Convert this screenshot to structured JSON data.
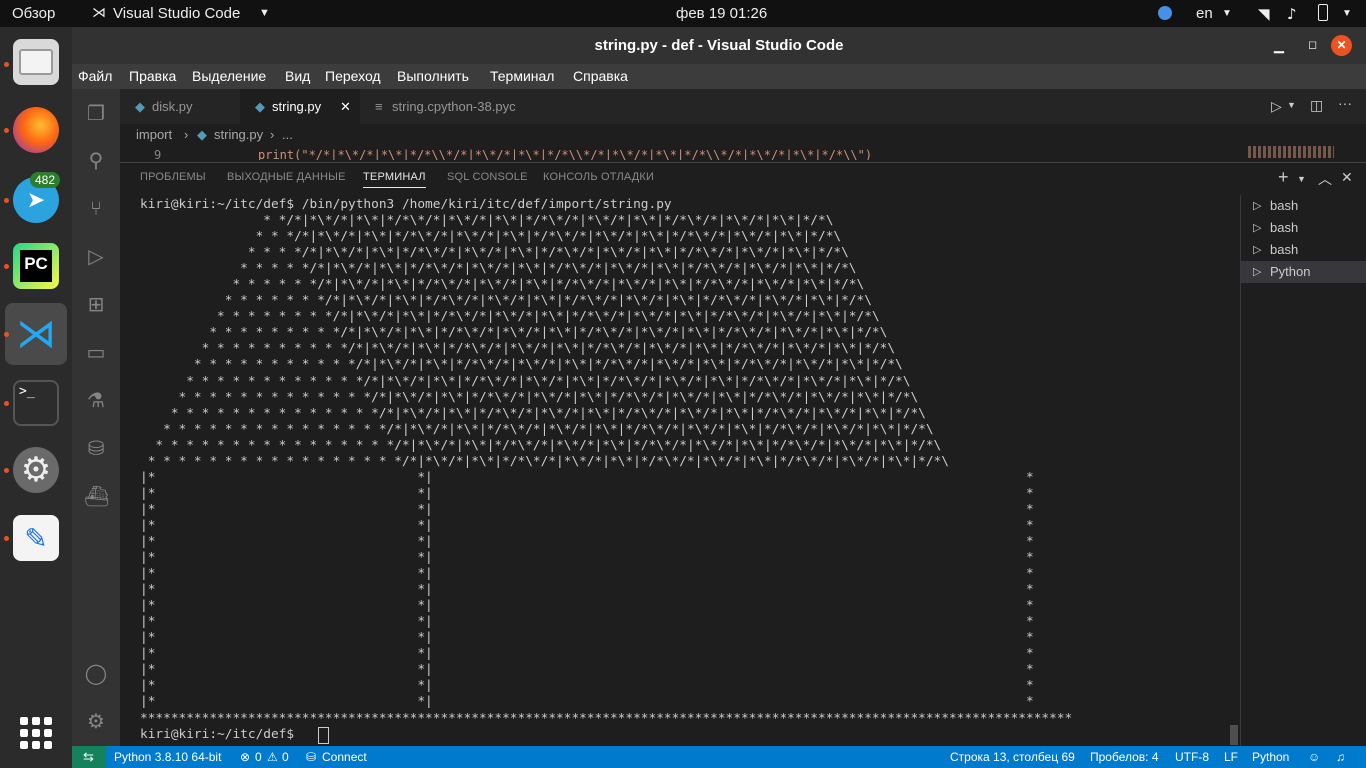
{
  "topbar": {
    "overview": "Обзор",
    "app_name": "Visual Studio Code",
    "datetime": "фев 19  01:26",
    "lang": "en"
  },
  "dock": {
    "telegram_badge": "482"
  },
  "window": {
    "title": "string.py - def - Visual Studio Code"
  },
  "menu": [
    "Файл",
    "Правка",
    "Выделение",
    "Вид",
    "Переход",
    "Выполнить",
    "Терминал",
    "Справка"
  ],
  "tabs": [
    {
      "label": "disk.py"
    },
    {
      "label": "string.py"
    },
    {
      "label": "string.cpython-38.pyc"
    }
  ],
  "breadcrumb": {
    "folder": "import",
    "file": "string.py",
    "more": "..."
  },
  "editor": {
    "line_number": "9",
    "code": "print(\"*/*|*\\*/*|*\\*|*/*\\\\*/*|*\\*/*|*\\*|*/*\\\\*/*|*\\*/*|*\\*|*/*\\\\*/*|*\\*/*|*\\*|*/*\\\\\")"
  },
  "panel": {
    "tabs": [
      "ПРОБЛЕМЫ",
      "ВЫХОДНЫЕ ДАННЫЕ",
      "ТЕРМИНАЛ",
      "SQL CONSOLE",
      "КОНСОЛЬ ОТЛАДКИ"
    ],
    "active_tab": "ТЕРМИНАЛ"
  },
  "terminal": {
    "output": "kiri@kiri:~/itc/def$ /bin/python3 /home/kiri/itc/def/import/string.py\n                * */*|*\\*/*|*\\*|*/*\\*/*|*\\*/*|*\\*|*/*\\*/*|*\\*/*|*\\*|*/*\\*/*|*\\*/*|*\\*|*/*\\\n               * * */*|*\\*/*|*\\*|*/*\\*/*|*\\*/*|*\\*|*/*\\*/*|*\\*/*|*\\*|*/*\\*/*|*\\*/*|*\\*|*/*\\\n              * * * */*|*\\*/*|*\\*|*/*\\*/*|*\\*/*|*\\*|*/*\\*/*|*\\*/*|*\\*|*/*\\*/*|*\\*/*|*\\*|*/*\\\n             * * * * */*|*\\*/*|*\\*|*/*\\*/*|*\\*/*|*\\*|*/*\\*/*|*\\*/*|*\\*|*/*\\*/*|*\\*/*|*\\*|*/*\\\n            * * * * * */*|*\\*/*|*\\*|*/*\\*/*|*\\*/*|*\\*|*/*\\*/*|*\\*/*|*\\*|*/*\\*/*|*\\*/*|*\\*|*/*\\\n           * * * * * * */*|*\\*/*|*\\*|*/*\\*/*|*\\*/*|*\\*|*/*\\*/*|*\\*/*|*\\*|*/*\\*/*|*\\*/*|*\\*|*/*\\\n          * * * * * * * */*|*\\*/*|*\\*|*/*\\*/*|*\\*/*|*\\*|*/*\\*/*|*\\*/*|*\\*|*/*\\*/*|*\\*/*|*\\*|*/*\\\n         * * * * * * * * */*|*\\*/*|*\\*|*/*\\*/*|*\\*/*|*\\*|*/*\\*/*|*\\*/*|*\\*|*/*\\*/*|*\\*/*|*\\*|*/*\\\n        * * * * * * * * * */*|*\\*/*|*\\*|*/*\\*/*|*\\*/*|*\\*|*/*\\*/*|*\\*/*|*\\*|*/*\\*/*|*\\*/*|*\\*|*/*\\\n       * * * * * * * * * * */*|*\\*/*|*\\*|*/*\\*/*|*\\*/*|*\\*|*/*\\*/*|*\\*/*|*\\*|*/*\\*/*|*\\*/*|*\\*|*/*\\\n      * * * * * * * * * * * */*|*\\*/*|*\\*|*/*\\*/*|*\\*/*|*\\*|*/*\\*/*|*\\*/*|*\\*|*/*\\*/*|*\\*/*|*\\*|*/*\\\n     * * * * * * * * * * * * */*|*\\*/*|*\\*|*/*\\*/*|*\\*/*|*\\*|*/*\\*/*|*\\*/*|*\\*|*/*\\*/*|*\\*/*|*\\*|*/*\\\n    * * * * * * * * * * * * * */*|*\\*/*|*\\*|*/*\\*/*|*\\*/*|*\\*|*/*\\*/*|*\\*/*|*\\*|*/*\\*/*|*\\*/*|*\\*|*/*\\\n   * * * * * * * * * * * * * * */*|*\\*/*|*\\*|*/*\\*/*|*\\*/*|*\\*|*/*\\*/*|*\\*/*|*\\*|*/*\\*/*|*\\*/*|*\\*|*/*\\\n  * * * * * * * * * * * * * * * */*|*\\*/*|*\\*|*/*\\*/*|*\\*/*|*\\*|*/*\\*/*|*\\*/*|*\\*|*/*\\*/*|*\\*/*|*\\*|*/*\\\n * * * * * * * * * * * * * * * * */*|*\\*/*|*\\*|*/*\\*/*|*\\*/*|*\\*|*/*\\*/*|*\\*/*|*\\*|*/*\\*/*|*\\*/*|*\\*|*/*\\\n|*                                  *|                                                                             *\n|*                                  *|                                                                             *\n|*                                  *|                                                                             *\n|*                                  *|                                                                             *\n|*                                  *|                                                                             *\n|*                                  *|                                                                             *\n|*                                  *|                                                                             *\n|*                                  *|                                                                             *\n|*                                  *|                                                                             *\n|*                                  *|                                                                             *\n|*                                  *|                                                                             *\n|*                                  *|                                                                             *\n|*                                  *|                                                                             *\n|*                                  *|                                                                             *\n|*                                  *|                                                                             *\n*************************************************************************************************************************\nkiri@kiri:~/itc/def$ ",
    "sessions": [
      "bash",
      "bash",
      "bash",
      "Python"
    ]
  },
  "status": {
    "interpreter": "Python 3.8.10 64-bit",
    "errors": "0",
    "warnings": "0",
    "connect": "Connect",
    "cursor": "Строка 13, столбец 69",
    "indent": "Пробелов: 4",
    "encoding": "UTF-8",
    "eol": "LF",
    "language": "Python"
  },
  "colors": {
    "accent": "#007acc",
    "ubuntu_orange": "#e95420"
  }
}
